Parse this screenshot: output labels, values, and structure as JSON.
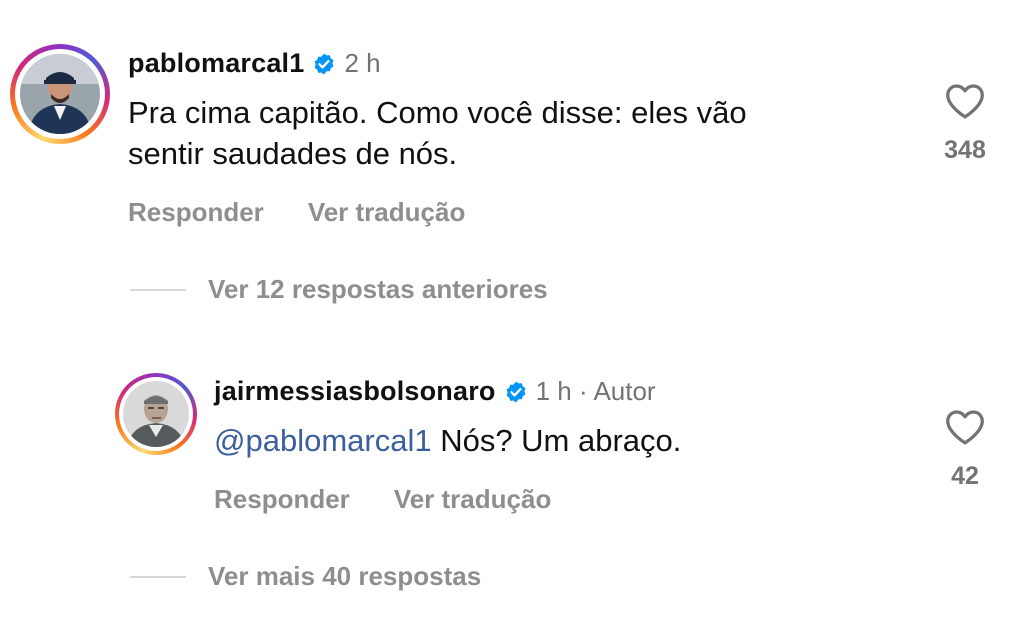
{
  "comments": [
    {
      "username": "pablomarcal1",
      "time": "2 h",
      "text_lines": [
        "Pra cima capitão. Como você disse: eles vão",
        "sentir saudades de nós."
      ],
      "reply_label": "Responder",
      "translate_label": "Ver tradução",
      "like_count": "348",
      "replies_toggle": "Ver 12 respostas anteriores"
    },
    {
      "username": "jairmessiasbolsonaro",
      "time": "1 h · Autor",
      "mention": "@pablomarcal1",
      "text": " Nós? Um abraço.",
      "reply_label": "Responder",
      "translate_label": "Ver tradução",
      "like_count": "42",
      "replies_toggle": "Ver mais 40 respostas"
    }
  ],
  "icons": {
    "verified": "verified-badge-icon",
    "like": "heart-outline-icon"
  },
  "colors": {
    "verified_blue": "#0095f6",
    "mention": "#3a5f9c",
    "secondary_text": "#8e8e8e"
  }
}
